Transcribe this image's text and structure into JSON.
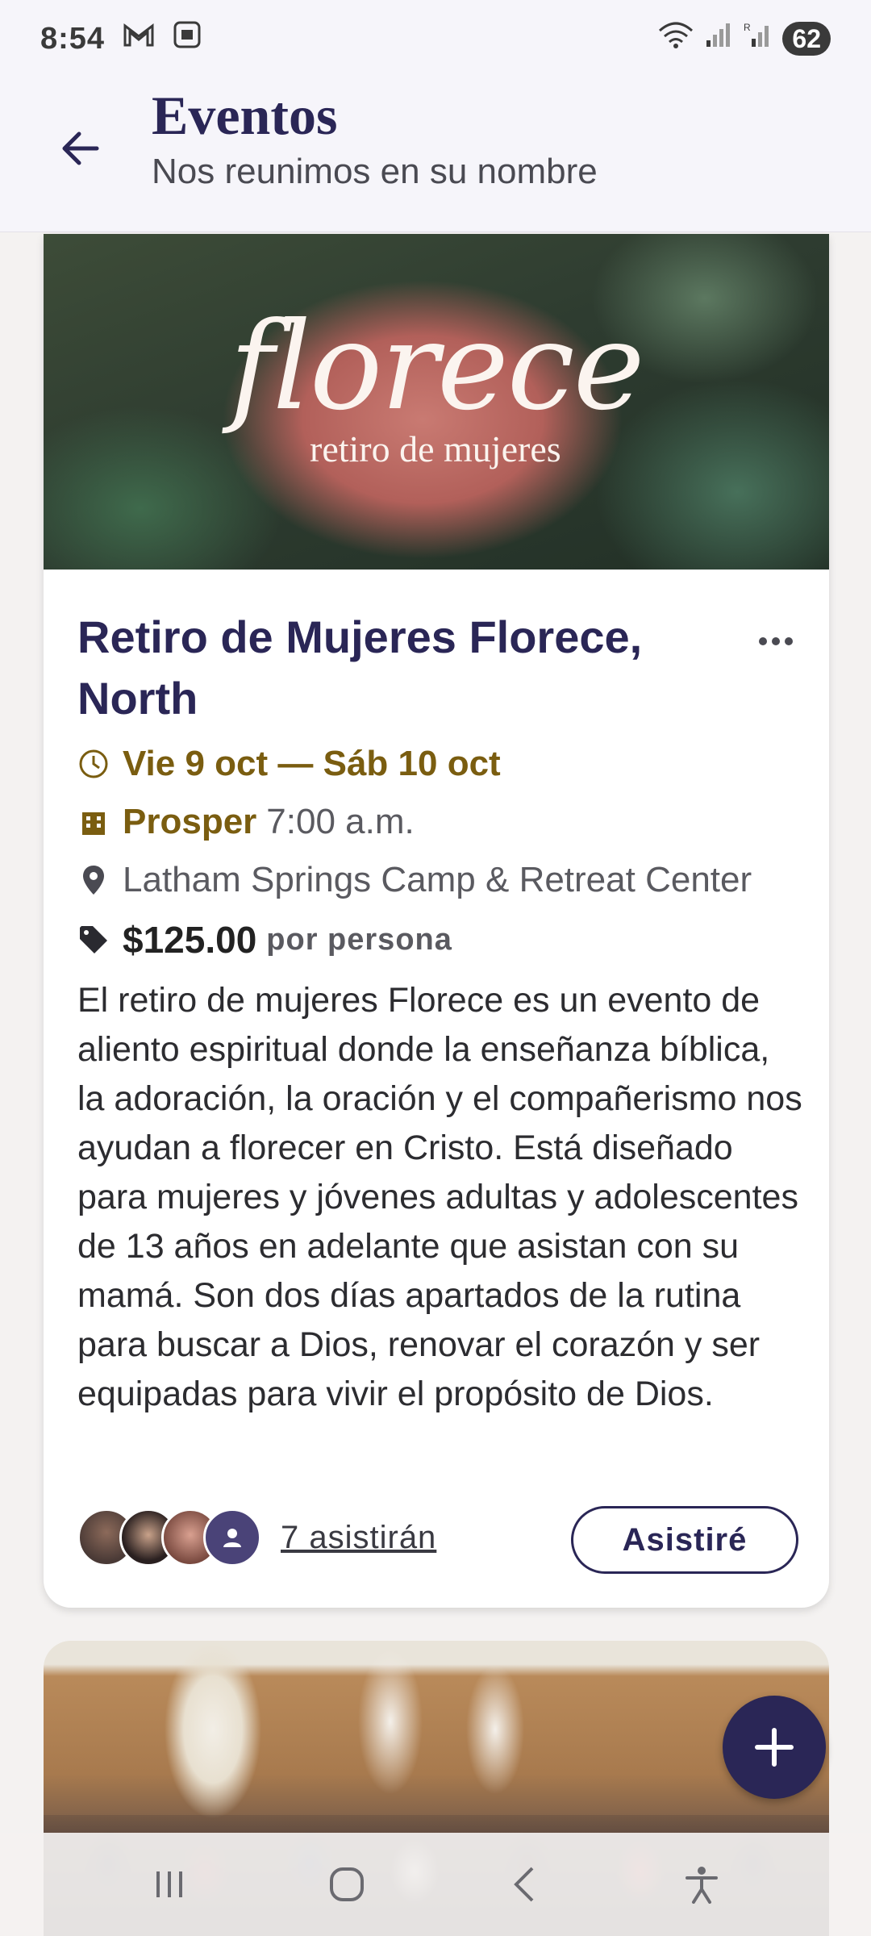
{
  "status_bar": {
    "time": "8:54",
    "battery": "62"
  },
  "header": {
    "title": "Eventos",
    "subtitle": "Nos reunimos en su nombre"
  },
  "event": {
    "image_text": "florece",
    "image_subtext": "retiro de mujeres",
    "title": "Retiro de Mujeres Florece, North",
    "dates": "Vie 9 oct — Sáb 10 oct",
    "campus": "Prosper",
    "time": "7:00 a.m.",
    "location": "Latham Springs Camp & Retreat Center",
    "price": "$125.00",
    "price_unit": "por persona",
    "description": "El retiro de mujeres Florece es un evento de aliento espiritual donde la enseñanza bíblica, la adoración, la oración y el compañerismo nos ayudan a florecer en Cristo. Está diseñado para mujeres y jóvenes adultas y adolescentes de 13 años en adelante que asistan con su mamá. Son dos días apartados de la rutina para buscar a Dios, renovar el corazón y ser equipadas para vivir el propósito de Dios.",
    "attendees_label": "7 asistirán",
    "attend_button": "Asistiré"
  },
  "colors": {
    "primary": "#2a2656",
    "accent_gold": "#7a5d10",
    "background": "#f4f2f1"
  },
  "icons": [
    "back-arrow-icon",
    "clock-icon",
    "building-icon",
    "location-pin-icon",
    "price-tag-icon",
    "more-icon",
    "plus-icon"
  ]
}
